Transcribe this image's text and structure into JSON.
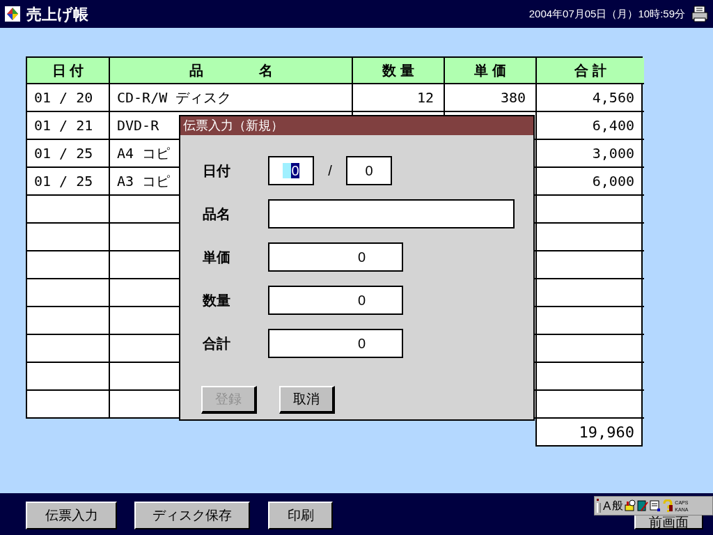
{
  "title_bar": {
    "app_title": "売上げ帳",
    "datetime": "2004年07月05日（月）10時:59分"
  },
  "table": {
    "columns": [
      "日 付",
      "品　　　　名",
      "数 量",
      "単 価",
      "合 計"
    ],
    "rows": [
      {
        "date": "01 / 20",
        "item": "CD-R/W ディスク",
        "quantity": "12",
        "unit_price": "380",
        "total": "4,560"
      },
      {
        "date": "01 / 21",
        "item": "DVD-R",
        "total": "6,400"
      },
      {
        "date": "01 / 25",
        "item": "A4 コピ",
        "total": "3,000"
      },
      {
        "date": "01 / 25",
        "item": "A3 コピ",
        "total": "6,000"
      }
    ],
    "grand_total": "19,960"
  },
  "dialog": {
    "title": "伝票入力（新規）",
    "fields": [
      {
        "kind": "date",
        "label": "日付",
        "month": "0",
        "month_selected": true,
        "separator": "/",
        "day": "0"
      },
      {
        "kind": "text",
        "label": "品名"
      },
      {
        "kind": "number",
        "label": "単価",
        "value": "0"
      },
      {
        "kind": "number",
        "label": "数量",
        "value": "0"
      },
      {
        "kind": "number",
        "label": "合計",
        "value": "0"
      }
    ],
    "buttons": [
      {
        "label": "登録",
        "disabled": true
      },
      {
        "label": "取消",
        "disabled": false
      }
    ]
  },
  "bottom_buttons": [
    {
      "label": "伝票入力"
    },
    {
      "label": "ディスク保存"
    },
    {
      "label": "印刷"
    },
    {
      "label": "前画面"
    }
  ],
  "ime_toolbar": {
    "input_char": "A",
    "mode": "般",
    "caps": "CAPS",
    "kana": "KANA"
  }
}
